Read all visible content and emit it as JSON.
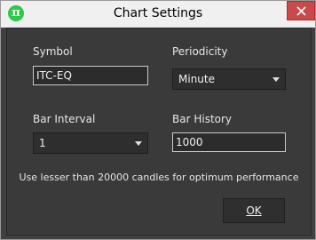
{
  "window": {
    "title": "Chart Settings",
    "app_icon_glyph": "π",
    "app_icon_name": "pi-app-icon",
    "close_icon_name": "close-icon"
  },
  "form": {
    "symbol": {
      "label": "Symbol",
      "value": "ITC-EQ"
    },
    "periodicity": {
      "label": "Periodicity",
      "selected": "Minute"
    },
    "bar_interval": {
      "label": "Bar Interval",
      "selected": "1"
    },
    "bar_history": {
      "label": "Bar History",
      "value": "1000"
    },
    "hint": "Use lesser than 20000 candles for optimum performance",
    "ok_label": "OK"
  },
  "colors": {
    "background": "#3a3a3a",
    "titlebar": "#f0f0f0",
    "close_button": "#c84a4a",
    "app_icon": "#2ec84a"
  }
}
